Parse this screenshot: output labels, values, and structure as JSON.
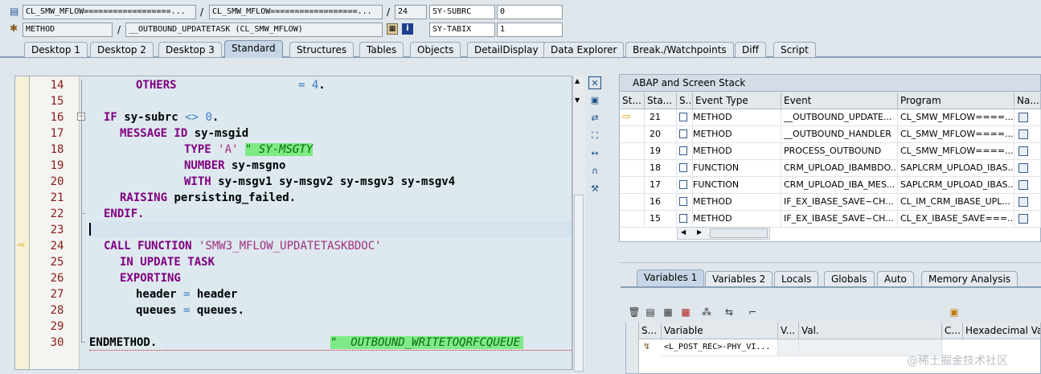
{
  "top": {
    "row1": {
      "field_program": "CL_SMW_MFLOW==================...",
      "sep1": "/",
      "field_include": "CL_SMW_MFLOW==================...",
      "sep2": "/",
      "field_line": "24",
      "var1_name": "SY-SUBRC",
      "var1_value": "0"
    },
    "row2": {
      "field_type": "METHOD",
      "sep1": "/",
      "field_event": "__OUTBOUND_UPDATETASK (CL_SMW_MFLOW)",
      "var2_name": "SY-TABIX",
      "var2_value": "1"
    }
  },
  "tabs": [
    "Desktop 1",
    "Desktop 2",
    "Desktop 3",
    "Standard",
    "Structures",
    "Tables",
    "Objects",
    "DetailDisplay",
    "Data Explorer",
    "Break./Watchpoints",
    "Diff",
    "Script"
  ],
  "active_tab": "Standard",
  "editor": {
    "lines": [
      {
        "n": "14"
      },
      {
        "n": "15"
      },
      {
        "n": "16"
      },
      {
        "n": "17"
      },
      {
        "n": "18"
      },
      {
        "n": "19"
      },
      {
        "n": "20"
      },
      {
        "n": "21"
      },
      {
        "n": "22"
      },
      {
        "n": "23"
      },
      {
        "n": "24"
      },
      {
        "n": "25"
      },
      {
        "n": "26"
      },
      {
        "n": "27"
      },
      {
        "n": "28"
      },
      {
        "n": "29"
      },
      {
        "n": "30"
      }
    ],
    "t14a": "OTHERS",
    "t14b": "= ",
    "t14c": "4",
    "t14d": ".",
    "t16a": "IF",
    "t16b": " sy-subrc ",
    "t16c": "<>",
    "t16d": " 0",
    "t16e": ".",
    "t17a": "MESSAGE ID",
    "t17b": " sy-msgid",
    "t18a": "TYPE",
    "t18b": " 'A' ",
    "t18c": "\" SY-MSGTY",
    "t19a": "NUMBER",
    "t19b": " sy-msgno",
    "t20a": "WITH",
    "t20b": " sy-msgv1 sy-msgv2 sy-msgv3 sy-msgv4",
    "t21a": "RAISING",
    "t21b": " persisting_failed.",
    "t22a": "ENDIF.",
    "t24a": "CALL FUNCTION",
    "t24b": " 'SMW3_MFLOW_UPDATETASKBDOC'",
    "t25a": "IN UPDATE TASK",
    "t26a": "EXPORTING",
    "t27a": "header ",
    "t27b": "=",
    "t27c": " header",
    "t28a": "queues ",
    "t28b": "=",
    "t28c": " queues.",
    "t30a": "ENDMETHOD.",
    "t30b": "\"  OUTBOUND_WRITETOQRFCQUEUE"
  },
  "stack": {
    "title": "ABAP and Screen Stack",
    "headers": [
      "St...",
      "Sta...",
      "S...",
      "Event Type",
      "Event",
      "Program",
      "Na..."
    ],
    "rows": [
      {
        "level": "21",
        "type": "METHOD",
        "event": "__OUTBOUND_UPDATE...",
        "program": "CL_SMW_MFLOW====..."
      },
      {
        "level": "20",
        "type": "METHOD",
        "event": "__OUTBOUND_HANDLER",
        "program": "CL_SMW_MFLOW====..."
      },
      {
        "level": "19",
        "type": "METHOD",
        "event": "PROCESS_OUTBOUND",
        "program": "CL_SMW_MFLOW====..."
      },
      {
        "level": "18",
        "type": "FUNCTION",
        "event": "CRM_UPLOAD_IBAMBDO...",
        "program": "SAPLCRM_UPLOAD_IBAS..."
      },
      {
        "level": "17",
        "type": "FUNCTION",
        "event": "CRM_UPLOAD_IBA_MES...",
        "program": "SAPLCRM_UPLOAD_IBAS..."
      },
      {
        "level": "16",
        "type": "METHOD",
        "event": "IF_EX_IBASE_SAVE~CH...",
        "program": "CL_IM_CRM_IBASE_UPL..."
      },
      {
        "level": "15",
        "type": "METHOD",
        "event": "IF_EX_IBASE_SAVE~CH...",
        "program": "CL_EX_IBASE_SAVE===..."
      }
    ]
  },
  "vartabs": [
    "Variables 1",
    "Variables 2",
    "Locals",
    "Globals",
    "Auto",
    "Memory Analysis"
  ],
  "vars": {
    "headers": [
      "S...",
      "Variable",
      "V...",
      "Val.",
      "C...",
      "Hexadecimal Valu"
    ],
    "row1_variable": "<L_POST_REC>-PHY_VI..."
  },
  "watermark": "@稀土掘金技术社区"
}
